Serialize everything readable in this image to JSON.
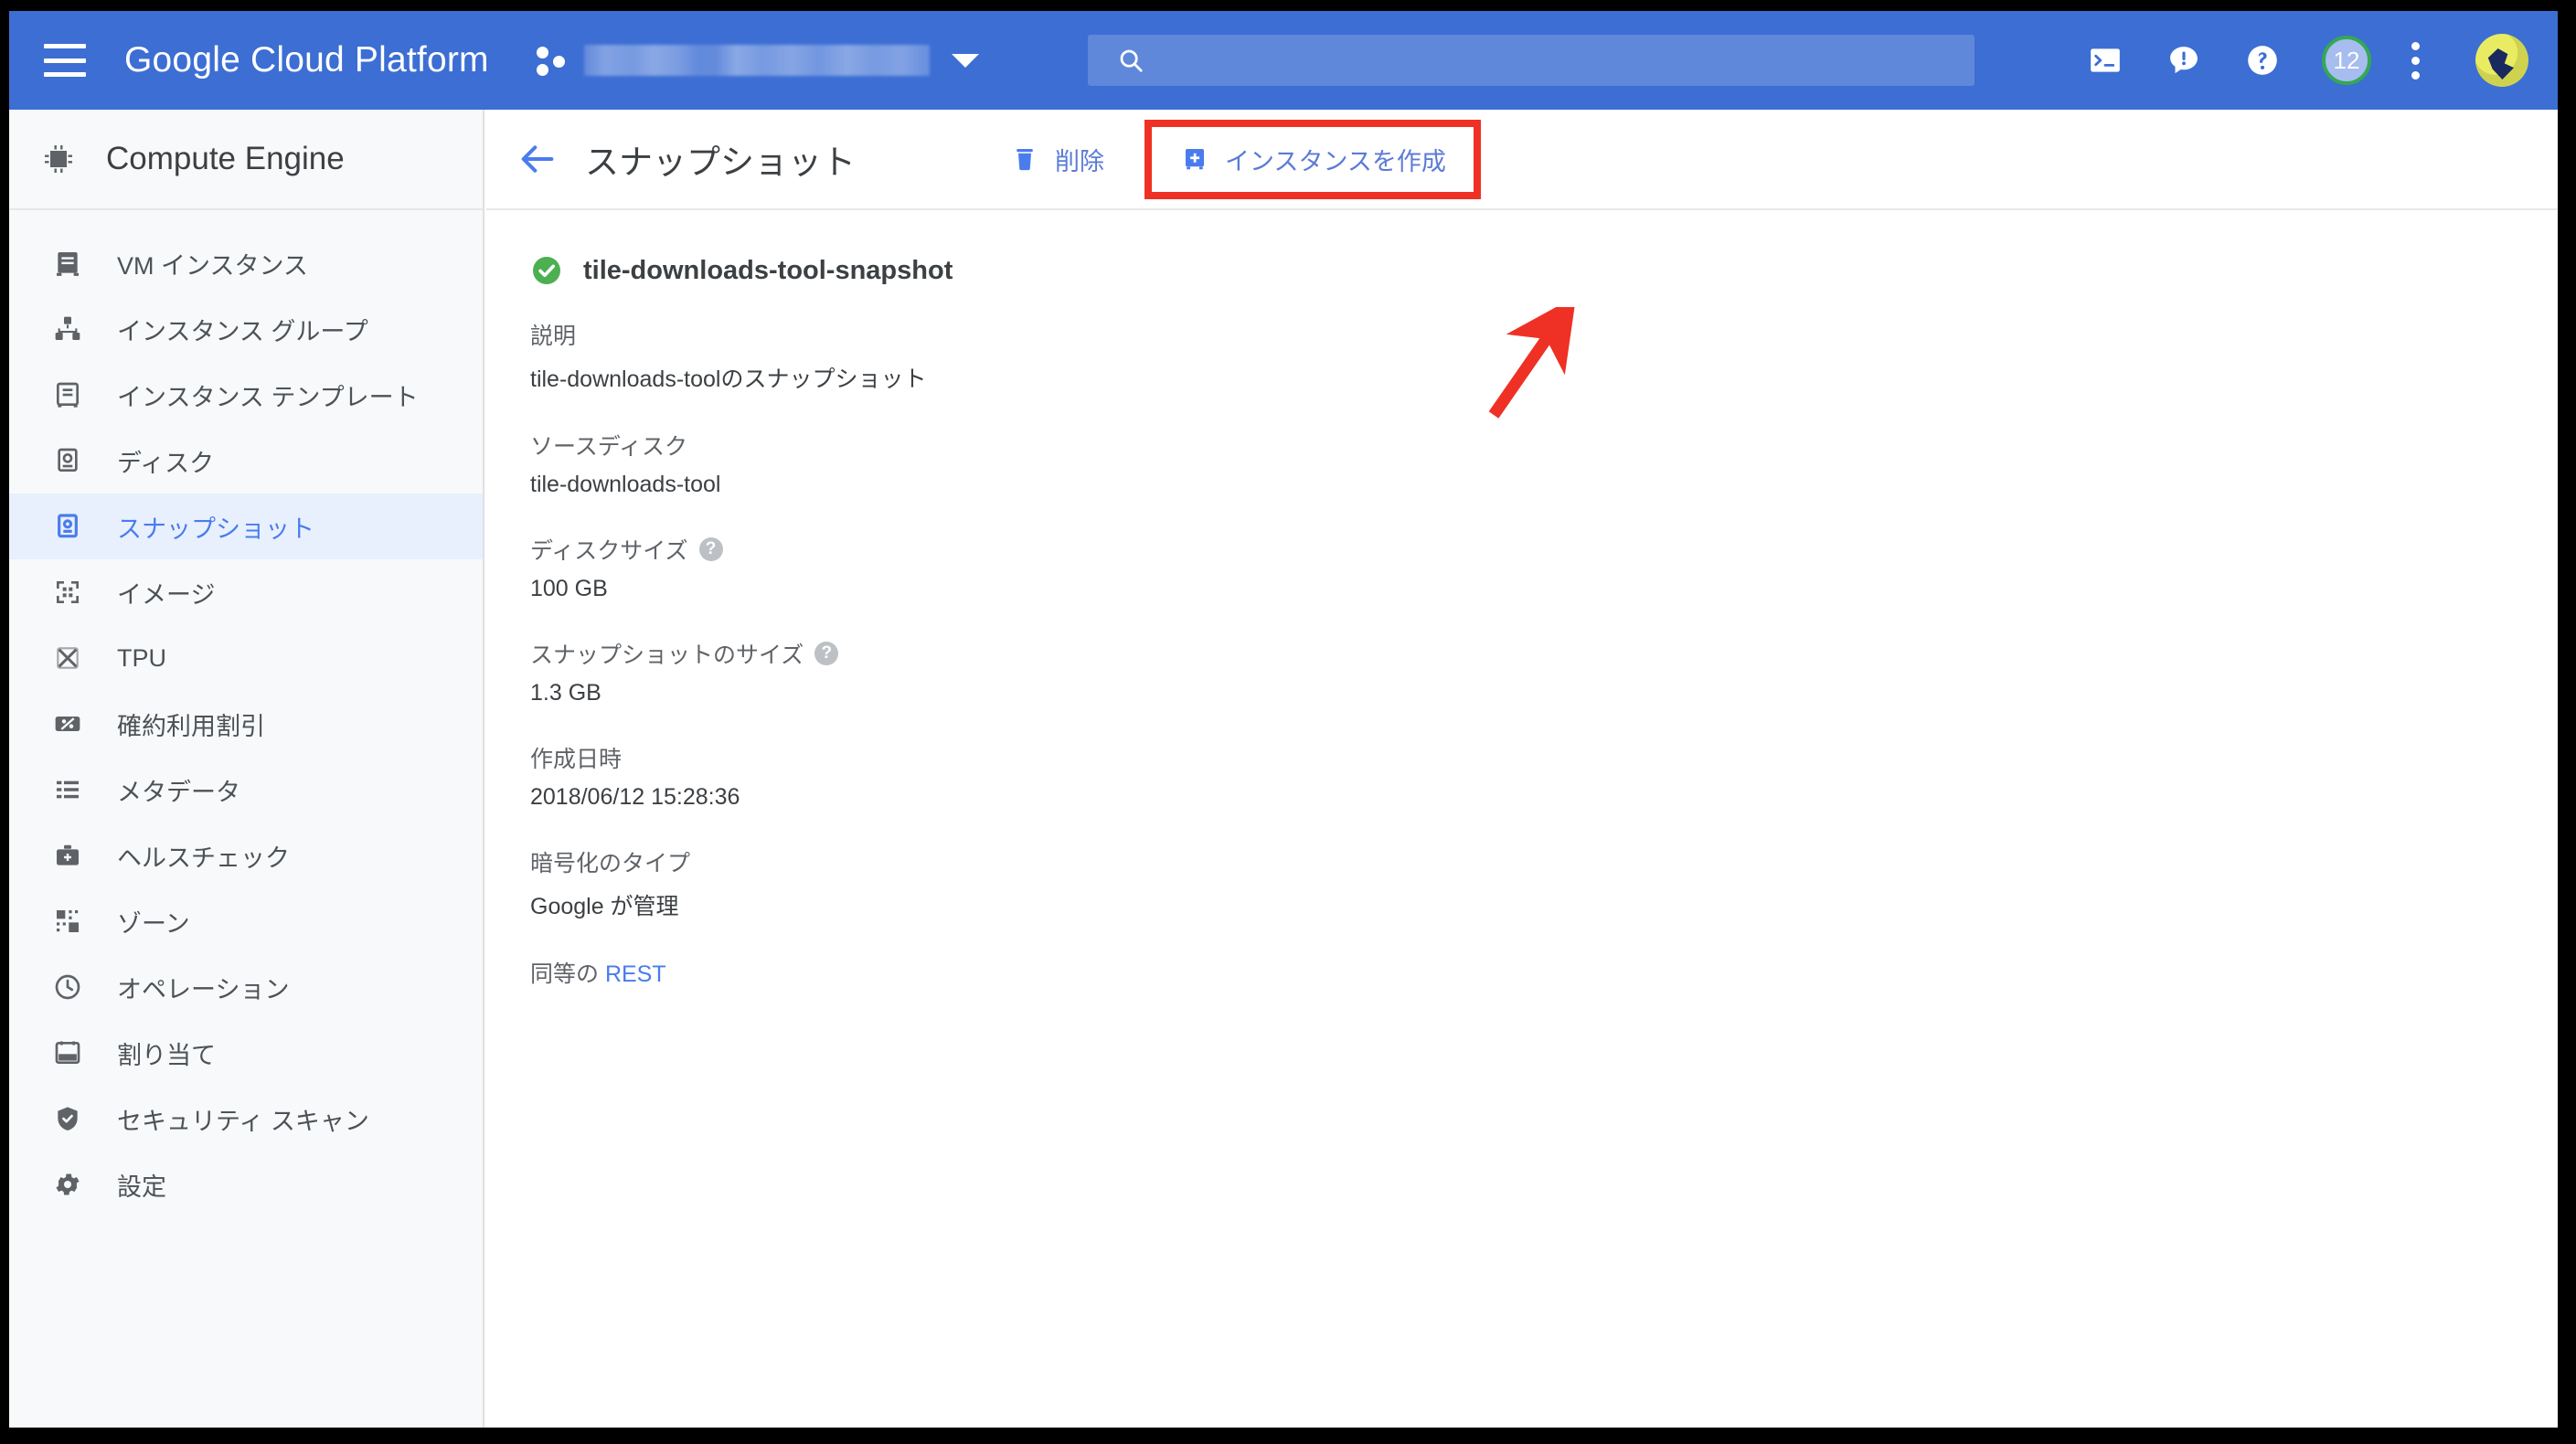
{
  "header": {
    "menu_icon": "hamburger-menu-icon",
    "brand": "Google Cloud Platform",
    "project_icon": "project-dots-icon",
    "project_name": "",
    "project_caret": "chevron-down-icon",
    "search_placeholder": "",
    "search_value": "",
    "search_icon": "search-icon",
    "icons": [
      {
        "name": "cloud-shell-icon"
      },
      {
        "name": "notifications-icon"
      },
      {
        "name": "help-icon"
      }
    ],
    "badge_count": "12",
    "kebab_icon": "more-vert-icon",
    "avatar": "user-avatar",
    "bg_color": "#3c6ed4"
  },
  "sidebar": {
    "product_icon": "chip-icon",
    "product_title": "Compute Engine",
    "active_index": 4,
    "items": [
      {
        "label": "VM インスタンス",
        "icon": "vm-instance-icon"
      },
      {
        "label": "インスタンス グループ",
        "icon": "instance-group-icon"
      },
      {
        "label": "インスタンス テンプレート",
        "icon": "instance-template-icon"
      },
      {
        "label": "ディスク",
        "icon": "disk-icon"
      },
      {
        "label": "スナップショット",
        "icon": "snapshot-icon"
      },
      {
        "label": "イメージ",
        "icon": "image-icon"
      },
      {
        "label": "TPU",
        "icon": "tpu-icon"
      },
      {
        "label": "確約利用割引",
        "icon": "percent-icon"
      },
      {
        "label": "メタデータ",
        "icon": "metadata-icon"
      },
      {
        "label": "ヘルスチェック",
        "icon": "health-check-icon"
      },
      {
        "label": "ゾーン",
        "icon": "zone-icon"
      },
      {
        "label": "オペレーション",
        "icon": "operations-clock-icon"
      },
      {
        "label": "割り当て",
        "icon": "quota-icon"
      },
      {
        "label": "セキュリティ スキャン",
        "icon": "security-shield-icon"
      },
      {
        "label": "設定",
        "icon": "settings-gear-icon"
      }
    ]
  },
  "toolbar": {
    "back_icon": "back-arrow-icon",
    "title": "スナップショット",
    "delete_label": "削除",
    "delete_icon": "trash-icon",
    "create_instance_label": "インスタンスを作成",
    "create_instance_icon": "create-instance-icon",
    "highlight_color": "#ee3124"
  },
  "detail": {
    "status_icon": "green-check-icon",
    "snapshot_name": "tile-downloads-tool-snapshot",
    "fields": [
      {
        "label": "説明",
        "value": "tile-downloads-toolのスナップショット",
        "help": false
      },
      {
        "label": "ソースディスク",
        "value": "tile-downloads-tool",
        "help": false
      },
      {
        "label": "ディスクサイズ",
        "value": "100 GB",
        "help": true
      },
      {
        "label": "スナップショットのサイズ",
        "value": "1.3 GB",
        "help": true
      },
      {
        "label": "作成日時",
        "value": "2018/06/12 15:28:36",
        "help": false
      },
      {
        "label": "暗号化のタイプ",
        "value": "Google が管理",
        "help": false
      }
    ],
    "rest_prefix": "同等の ",
    "rest_link": "REST"
  },
  "annotation": {
    "arrow_icon": "red-arrow-annotation",
    "color": "#ee3124"
  }
}
